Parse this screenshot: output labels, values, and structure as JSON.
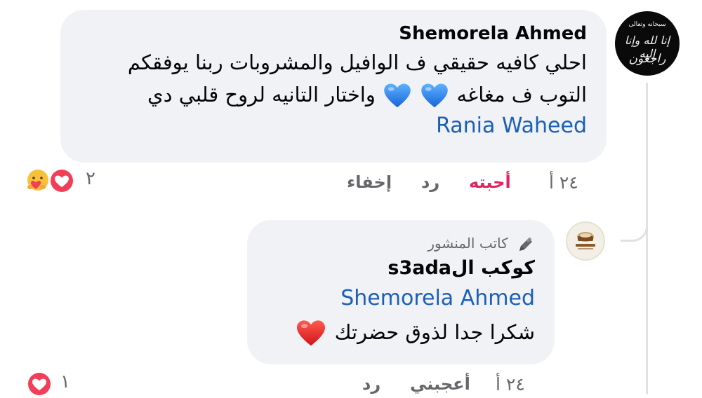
{
  "comment": {
    "author": "Shemorela Ahmed",
    "text_line1": "احلي كافيه حقيقي ف الوافيل والمشروبات ربنا يوفقكم",
    "text_line2_start": "التوب ف مغاغه",
    "text_line2_end": "واختار التانيه لروح قلبي دي",
    "inline_emoji": [
      "blue-heart",
      "blue-heart"
    ],
    "tagged_user": "Rania Waheed",
    "avatar_text_top": "إنا لله وإنا إليه",
    "avatar_text_bottom": "راجعون",
    "avatar_text_small": "سبحانه وتعالى",
    "actions": {
      "time": "٢٤ أ",
      "like": "أحبته",
      "reply": "رد",
      "hide": "إخفاء"
    },
    "reactions": {
      "count": "٢",
      "types": [
        "care",
        "love"
      ]
    },
    "colors": {
      "liked_action": "#e0245e",
      "tag": "#1b5fb8"
    }
  },
  "reply": {
    "badge": "كاتب المنشور",
    "author": "كوكب الs3ada",
    "tagged_user": "Shemorela Ahmed",
    "text": "شكرا جدا لذوق حضرتك",
    "inline_emoji": [
      "red-heart"
    ],
    "actions": {
      "time": "٢٤ أ",
      "like": "أعجبني",
      "reply": "رد"
    },
    "reactions": {
      "count": "١",
      "types": [
        "love"
      ]
    }
  }
}
